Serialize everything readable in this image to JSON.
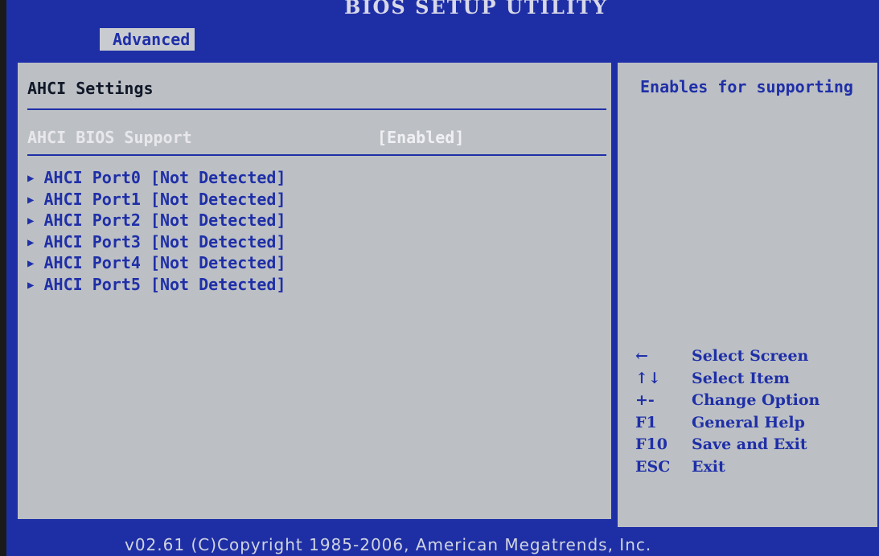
{
  "title": "BIOS SETUP UTILITY",
  "tab": "Advanced",
  "main": {
    "section_title": "AHCI Settings",
    "setting": {
      "label": "AHCI BIOS Support",
      "value": "[Enabled]"
    },
    "ports": [
      "AHCI Port0 [Not Detected]",
      "AHCI Port1 [Not Detected]",
      "AHCI Port2 [Not Detected]",
      "AHCI Port3 [Not Detected]",
      "AHCI Port4 [Not Detected]",
      "AHCI Port5 [Not Detected]"
    ],
    "port_arrow": "▶"
  },
  "help": {
    "text": "Enables for supporting",
    "keys": [
      {
        "key": "←",
        "desc": "Select Screen"
      },
      {
        "key": "↑↓",
        "desc": "Select Item"
      },
      {
        "key": "+-",
        "desc": "Change Option"
      },
      {
        "key": "F1",
        "desc": "General Help"
      },
      {
        "key": "F10",
        "desc": "Save and Exit"
      },
      {
        "key": "ESC",
        "desc": "Exit"
      }
    ]
  },
  "footer": "v02.61 (C)Copyright 1985-2006, American Megatrends, Inc.",
  "colors": {
    "bios_blue": "#1e2fa6",
    "panel_gray": "#bcc0c4",
    "text_blue": "#1f2fa8",
    "highlight_white": "#f0f0f4"
  }
}
